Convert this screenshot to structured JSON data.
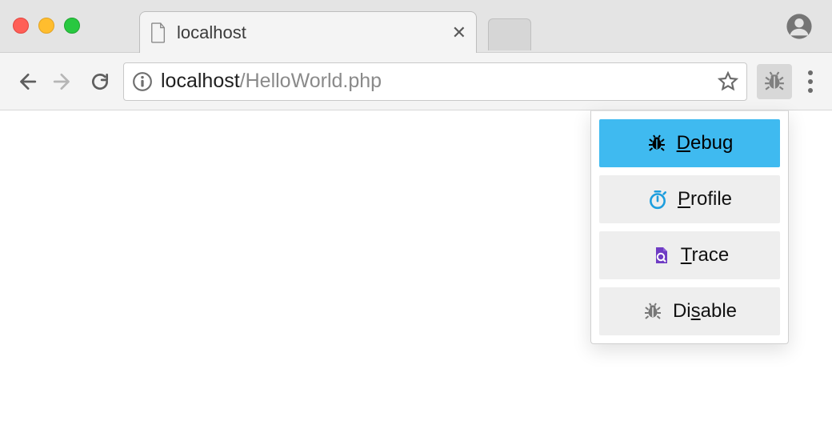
{
  "tab": {
    "title": "localhost"
  },
  "address": {
    "host": "localhost",
    "path": "/HelloWorld.php"
  },
  "menu": {
    "debug": {
      "pre": "",
      "u": "D",
      "post": "ebug"
    },
    "profile": {
      "pre": "",
      "u": "P",
      "post": "rofile"
    },
    "trace": {
      "pre": "",
      "u": "T",
      "post": "race"
    },
    "disable": {
      "pre": "Di",
      "u": "s",
      "post": "able"
    }
  }
}
